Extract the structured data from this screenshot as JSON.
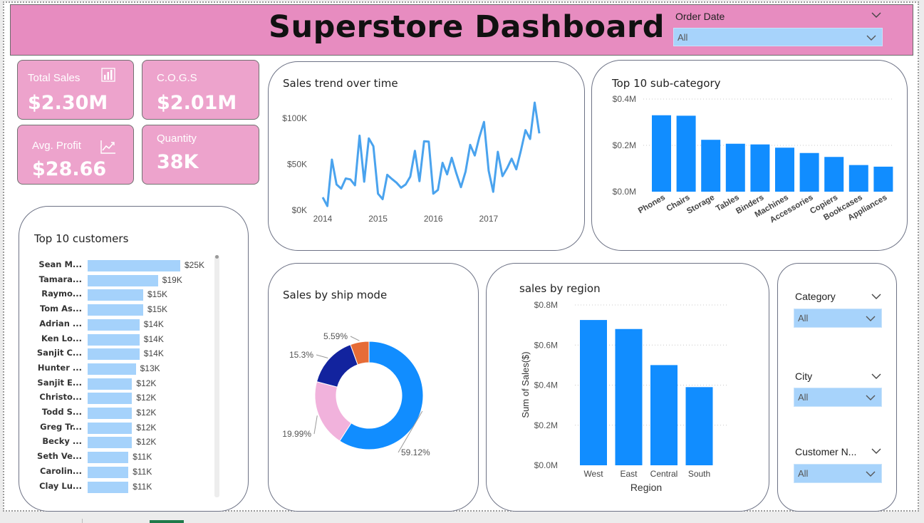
{
  "header": {
    "title": "Superstore Dashboard",
    "order_date_label": "Order Date",
    "order_date_value": "All"
  },
  "kpis": {
    "total_sales": {
      "label": "Total Sales",
      "value": "$2.30M"
    },
    "cogs": {
      "label": "C.O.G.S",
      "value": "$2.01M"
    },
    "avg_profit": {
      "label": "Avg. Profit",
      "value": "$28.66"
    },
    "quantity": {
      "label": "Quantity",
      "value": "38K"
    }
  },
  "colors": {
    "header_pink": "#e78cc0",
    "kpi_pink": "#eda3cc",
    "line_blue": "#4aa3ee",
    "bar_blue": "#118dff",
    "light_blue": "#a5d2fb",
    "donut_standard": "#118dff",
    "donut_second": "#f1b2dc",
    "donut_first": "#12239e",
    "donut_same_day": "#e66c37"
  },
  "icons": {
    "total_sales": "bar-chart-icon",
    "avg_profit": "trend-line-icon",
    "dropdown": "chevron-down-icon"
  },
  "sales_trend": {
    "title": "Sales trend over time",
    "chart_data": {
      "type": "line",
      "x_tick_labels": [
        "2014",
        "2015",
        "2016",
        "2017"
      ],
      "y_tick_labels": [
        "$0K",
        "$50K",
        "$100K"
      ],
      "ylim": [
        0,
        110000
      ],
      "x": [
        "2014-01",
        "2014-02",
        "2014-03",
        "2014-04",
        "2014-05",
        "2014-06",
        "2014-07",
        "2014-08",
        "2014-09",
        "2014-10",
        "2014-11",
        "2014-12",
        "2015-01",
        "2015-02",
        "2015-03",
        "2015-04",
        "2015-05",
        "2015-06",
        "2015-07",
        "2015-08",
        "2015-09",
        "2015-10",
        "2015-11",
        "2015-12",
        "2016-01",
        "2016-02",
        "2016-03",
        "2016-04",
        "2016-05",
        "2016-06",
        "2016-07",
        "2016-08",
        "2016-09",
        "2016-10",
        "2016-11",
        "2016-12",
        "2017-01",
        "2017-02",
        "2017-03",
        "2017-04",
        "2017-05",
        "2017-06",
        "2017-07",
        "2017-08",
        "2017-09",
        "2017-10",
        "2017-11",
        "2017-12"
      ],
      "values": [
        14000,
        4500,
        55000,
        28000,
        23500,
        34500,
        33500,
        27000,
        81000,
        31000,
        78000,
        69500,
        18000,
        12000,
        38500,
        34000,
        30000,
        24500,
        28000,
        36500,
        64500,
        31500,
        75000,
        74500,
        18000,
        22000,
        51500,
        39000,
        57000,
        40000,
        25000,
        42000,
        71000,
        59500,
        79500,
        96000,
        43000,
        20000,
        63500,
        37000,
        45500,
        56000,
        44500,
        64500,
        87000,
        77500,
        117000,
        83500
      ],
      "grid": false
    }
  },
  "subcategory": {
    "title": "Top 10 sub-category",
    "chart_data": {
      "type": "bar",
      "categories": [
        "Phones",
        "Chairs",
        "Storage",
        "Tables",
        "Binders",
        "Machines",
        "Accessories",
        "Copiers",
        "Bookcases",
        "Appliances"
      ],
      "values": [
        330000,
        328000,
        224000,
        207000,
        204000,
        190000,
        167000,
        150000,
        115000,
        108000
      ],
      "y_tick_labels": [
        "$0.0M",
        "$0.2M",
        "$0.4M"
      ],
      "ylim": [
        0,
        400000
      ],
      "grid": true
    }
  },
  "customers": {
    "title": "Top 10 customers",
    "chart_data": {
      "type": "bar",
      "orientation": "horizontal",
      "categories": [
        "Sean M...",
        "Tamara...",
        "Raymo...",
        "Tom As...",
        "Adrian ...",
        "Ken Lo...",
        "Sanjit C...",
        "Hunter ...",
        "Sanjit E...",
        "Christo...",
        "Todd S...",
        "Greg Tr...",
        "Becky ...",
        "Seth Ve...",
        "Carolin...",
        "Clay Lu..."
      ],
      "values": [
        25000,
        19000,
        15000,
        15000,
        14000,
        14000,
        14000,
        13000,
        12000,
        12000,
        12000,
        12000,
        12000,
        11000,
        11000,
        11000
      ],
      "data_labels": [
        "$25K",
        "$19K",
        "$15K",
        "$15K",
        "$14K",
        "$14K",
        "$14K",
        "$13K",
        "$12K",
        "$12K",
        "$12K",
        "$12K",
        "$12K",
        "$11K",
        "$11K",
        "$11K"
      ]
    }
  },
  "ship_mode": {
    "title": "Sales by ship mode",
    "chart_data": {
      "type": "pie",
      "donut": true,
      "values": [
        59.12,
        19.99,
        15.3,
        5.59
      ],
      "data_labels": [
        "59.12%",
        "19.99%",
        "15.3%",
        "5.59%"
      ]
    }
  },
  "region": {
    "title": "sales by region",
    "chart_data": {
      "type": "bar",
      "categories": [
        "West",
        "East",
        "Central",
        "South"
      ],
      "values": [
        725000,
        680000,
        500000,
        390000
      ],
      "xlabel": "Region",
      "ylabel": "Sum of Sales($)",
      "y_tick_labels": [
        "$0.0M",
        "$0.2M",
        "$0.4M",
        "$0.6M",
        "$0.8M"
      ],
      "ylim": [
        0,
        800000
      ],
      "grid": true
    }
  },
  "filters": {
    "category": {
      "label": "Category",
      "value": "All"
    },
    "city": {
      "label": "City",
      "value": "All"
    },
    "customer": {
      "label": "Customer N...",
      "value": "All"
    }
  }
}
